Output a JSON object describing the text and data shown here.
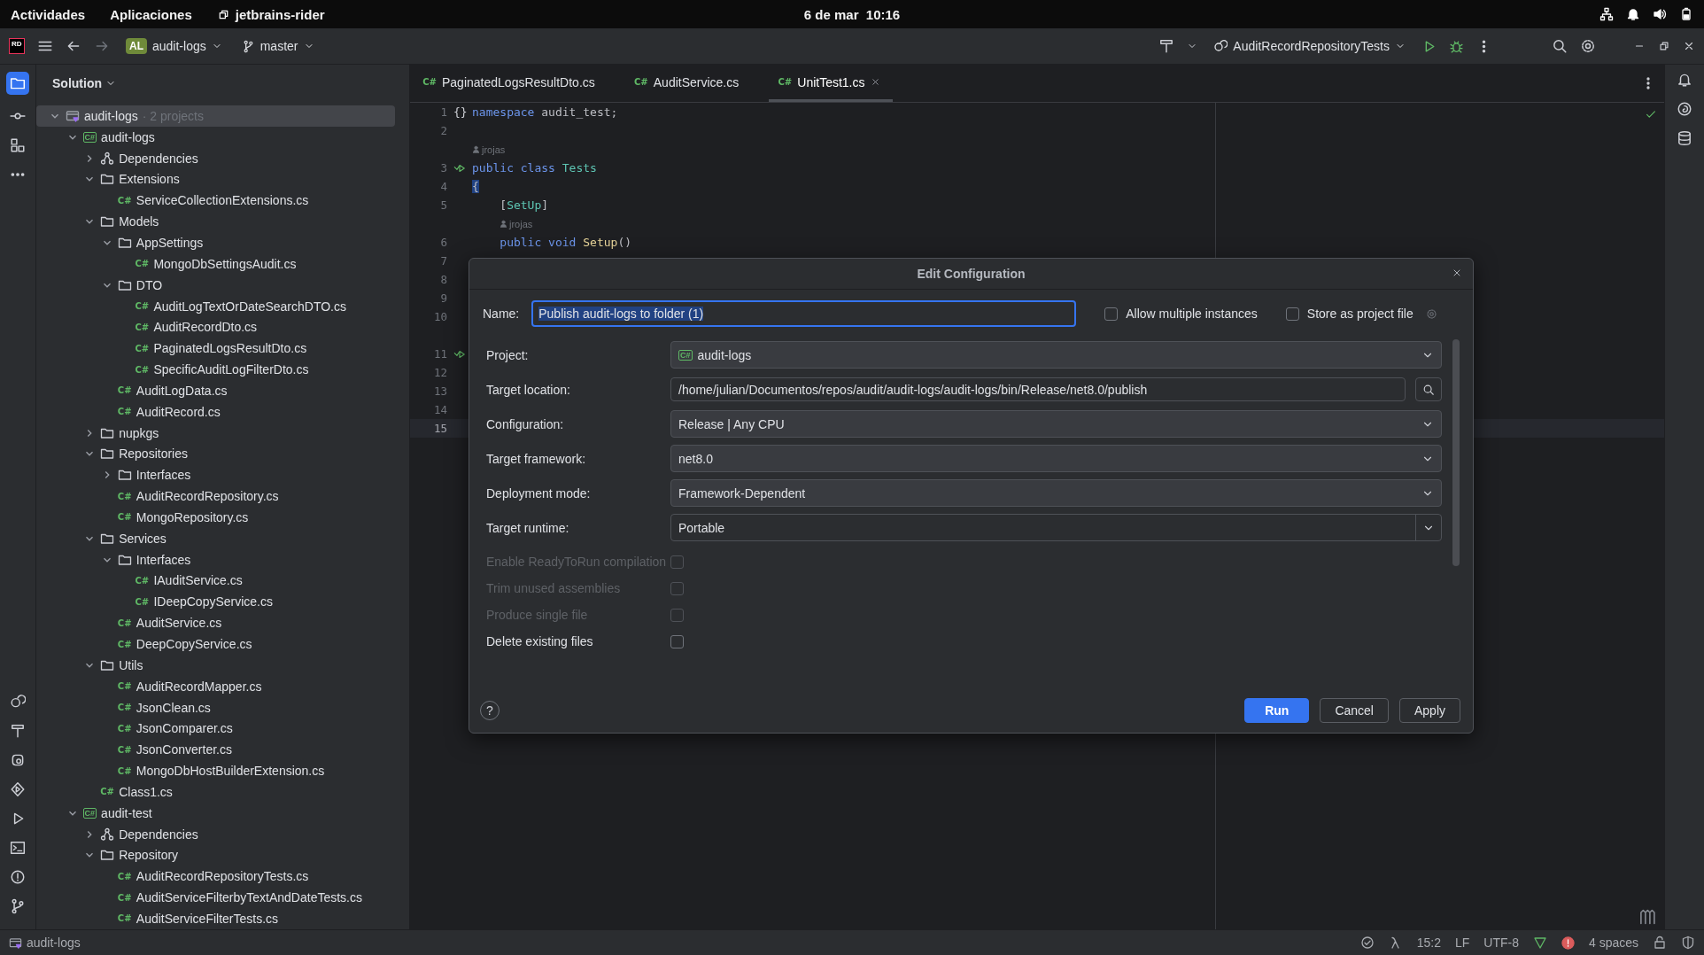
{
  "top_bar": {
    "activities": "Actividades",
    "applications": "Aplicaciones",
    "app": "jetbrains-rider",
    "clock": "6 de mar  10:16"
  },
  "toolbar": {
    "logo": "RD",
    "project_badge": "AL",
    "project": "audit-logs",
    "branch": "master",
    "run_config": "AuditRecordRepositoryTests"
  },
  "project_panel": {
    "title": "Solution",
    "tree": [
      {
        "label": "audit-logs",
        "kind": "solution",
        "note": "· 2 projects",
        "expanded": true,
        "selected": true,
        "children": [
          {
            "label": "audit-logs",
            "kind": "project",
            "icon_text": "C#",
            "expanded": true,
            "selected": false,
            "children": [
              {
                "label": "Dependencies",
                "kind": "dependencies",
                "expanded": false,
                "selected": false
              },
              {
                "label": "Extensions",
                "kind": "folder",
                "expanded": true,
                "selected": false,
                "children": [
                  {
                    "label": "ServiceCollectionExtensions.cs",
                    "kind": "file",
                    "icon_text": "C#",
                    "selected": false
                  }
                ]
              },
              {
                "label": "Models",
                "kind": "folder",
                "expanded": true,
                "selected": false,
                "children": [
                  {
                    "label": "AppSettings",
                    "kind": "folder",
                    "expanded": true,
                    "selected": false,
                    "children": [
                      {
                        "label": "MongoDbSettingsAudit.cs",
                        "kind": "file",
                        "icon_text": "C#",
                        "selected": false
                      }
                    ]
                  },
                  {
                    "label": "DTO",
                    "kind": "folder",
                    "expanded": true,
                    "selected": false,
                    "children": [
                      {
                        "label": "AuditLogTextOrDateSearchDTO.cs",
                        "kind": "file",
                        "icon_text": "C#",
                        "selected": false
                      },
                      {
                        "label": "AuditRecordDto.cs",
                        "kind": "file",
                        "icon_text": "C#",
                        "selected": false
                      },
                      {
                        "label": "PaginatedLogsResultDto.cs",
                        "kind": "file",
                        "icon_text": "C#",
                        "selected": false
                      },
                      {
                        "label": "SpecificAuditLogFilterDto.cs",
                        "kind": "file",
                        "icon_text": "C#",
                        "selected": false
                      }
                    ]
                  },
                  {
                    "label": "AuditLogData.cs",
                    "kind": "file",
                    "icon_text": "C#",
                    "selected": false
                  },
                  {
                    "label": "AuditRecord.cs",
                    "kind": "file",
                    "icon_text": "C#",
                    "selected": false
                  }
                ]
              },
              {
                "label": "nupkgs",
                "kind": "folder",
                "expanded": false,
                "selected": false
              },
              {
                "label": "Repositories",
                "kind": "folder",
                "expanded": true,
                "selected": false,
                "children": [
                  {
                    "label": "Interfaces",
                    "kind": "folder",
                    "expanded": false,
                    "selected": false
                  },
                  {
                    "label": "AuditRecordRepository.cs",
                    "kind": "file",
                    "icon_text": "C#",
                    "selected": false
                  },
                  {
                    "label": "MongoRepository.cs",
                    "kind": "file",
                    "icon_text": "C#",
                    "selected": false
                  }
                ]
              },
              {
                "label": "Services",
                "kind": "folder",
                "expanded": true,
                "selected": false,
                "children": [
                  {
                    "label": "Interfaces",
                    "kind": "folder",
                    "expanded": true,
                    "selected": false,
                    "children": [
                      {
                        "label": "IAuditService.cs",
                        "kind": "file",
                        "icon_text": "C#",
                        "selected": false
                      },
                      {
                        "label": "IDeepCopyService.cs",
                        "kind": "file",
                        "icon_text": "C#",
                        "selected": false
                      }
                    ]
                  },
                  {
                    "label": "AuditService.cs",
                    "kind": "file",
                    "icon_text": "C#",
                    "selected": false
                  },
                  {
                    "label": "DeepCopyService.cs",
                    "kind": "file",
                    "icon_text": "C#",
                    "selected": false
                  }
                ]
              },
              {
                "label": "Utils",
                "kind": "folder",
                "expanded": true,
                "selected": false,
                "children": [
                  {
                    "label": "AuditRecordMapper.cs",
                    "kind": "file",
                    "icon_text": "C#",
                    "selected": false
                  },
                  {
                    "label": "JsonClean.cs",
                    "kind": "file",
                    "icon_text": "C#",
                    "selected": false
                  },
                  {
                    "label": "JsonComparer.cs",
                    "kind": "file",
                    "icon_text": "C#",
                    "selected": false
                  },
                  {
                    "label": "JsonConverter.cs",
                    "kind": "file",
                    "icon_text": "C#",
                    "selected": false
                  },
                  {
                    "label": "MongoDbHostBuilderExtension.cs",
                    "kind": "file",
                    "icon_text": "C#",
                    "selected": false
                  }
                ]
              },
              {
                "label": "Class1.cs",
                "kind": "file",
                "icon_text": "C#",
                "selected": false
              }
            ]
          },
          {
            "label": "audit-test",
            "kind": "project",
            "icon_text": "C#",
            "expanded": true,
            "selected": false,
            "children": [
              {
                "label": "Dependencies",
                "kind": "dependencies",
                "expanded": false,
                "selected": false
              },
              {
                "label": "Repository",
                "kind": "folder",
                "expanded": true,
                "selected": false,
                "children": [
                  {
                    "label": "AuditRecordRepositoryTests.cs",
                    "kind": "file",
                    "icon_text": "C#",
                    "selected": false
                  },
                  {
                    "label": "AuditServiceFilterbyTextAndDateTests.cs",
                    "kind": "file",
                    "icon_text": "C#",
                    "selected": false
                  },
                  {
                    "label": "AuditServiceFilterTests.cs",
                    "kind": "file",
                    "icon_text": "C#",
                    "selected": false
                  }
                ]
              }
            ]
          }
        ]
      }
    ]
  },
  "editor": {
    "tabs": [
      {
        "icon_text": "C#",
        "label": "PaginatedLogsResultDto.cs",
        "selected": false,
        "closable": false
      },
      {
        "icon_text": "C#",
        "label": "AuditService.cs",
        "selected": false,
        "closable": false
      },
      {
        "icon_text": "C#",
        "label": "UnitTest1.cs",
        "selected": true,
        "closable": true
      }
    ],
    "lines": [
      {
        "kind": "code",
        "number": "1",
        "gutter_text": "{}",
        "runnable": false,
        "current": false,
        "segments": [
          {
            "kind": "keyword",
            "text": "namespace"
          },
          {
            "kind": "plain",
            "text": " audit_test;"
          }
        ]
      },
      {
        "kind": "code",
        "number": "2",
        "runnable": false,
        "current": false
      },
      {
        "kind": "author",
        "text": "jrojas",
        "indented": false
      },
      {
        "kind": "code",
        "number": "3",
        "runnable": true,
        "current": false,
        "segments": [
          {
            "kind": "keyword",
            "text": "public class "
          },
          {
            "kind": "type",
            "text": "Tests"
          }
        ]
      },
      {
        "kind": "code",
        "number": "4",
        "runnable": false,
        "current": false,
        "segments": [
          {
            "kind": "brace_match",
            "text": "{"
          }
        ]
      },
      {
        "kind": "code",
        "number": "5",
        "runnable": false,
        "current": false,
        "segments": [
          {
            "kind": "plain",
            "text": "    ["
          },
          {
            "kind": "type",
            "text": "SetUp"
          },
          {
            "kind": "plain",
            "text": "]"
          }
        ]
      },
      {
        "kind": "author",
        "text": "jrojas",
        "indented": true
      },
      {
        "kind": "code",
        "number": "6",
        "runnable": false,
        "current": false,
        "segments": [
          {
            "kind": "keyword",
            "text": "    public void "
          },
          {
            "kind": "method",
            "text": "Setup"
          },
          {
            "kind": "plain",
            "text": "()"
          }
        ]
      },
      {
        "kind": "code",
        "number": "7",
        "runnable": false,
        "current": false
      },
      {
        "kind": "code",
        "number": "8",
        "runnable": false,
        "current": false
      },
      {
        "kind": "code",
        "number": "9",
        "runnable": false,
        "current": false
      },
      {
        "kind": "code",
        "number": "10",
        "runnable": false,
        "current": false
      },
      {
        "kind": "author"
      },
      {
        "kind": "code",
        "number": "11",
        "runnable": true,
        "current": false
      },
      {
        "kind": "code",
        "number": "12",
        "runnable": false,
        "current": false
      },
      {
        "kind": "code",
        "number": "13",
        "runnable": false,
        "current": false
      },
      {
        "kind": "code",
        "number": "14",
        "runnable": false,
        "current": false
      },
      {
        "kind": "code",
        "number": "15",
        "runnable": false,
        "current": true
      }
    ]
  },
  "dialog": {
    "title": "Edit Configuration",
    "name_label": "Name:",
    "name_value": "Publish audit-logs to folder (1)",
    "header_checks": [
      {
        "label": "Allow multiple instances",
        "checked": false
      },
      {
        "label": "Store as project file",
        "checked": false
      }
    ],
    "fields": [
      {
        "label": "Project:",
        "kind": "dropdown",
        "icon_text": "C#",
        "value": "audit-logs"
      },
      {
        "label": "Target location:",
        "kind": "path",
        "value": "/home/julian/Documentos/repos/audit/audit-logs/audit-logs/bin/Release/net8.0/publish"
      },
      {
        "label": "Configuration:",
        "kind": "dropdown",
        "value": "Release | Any CPU"
      },
      {
        "label": "Target framework:",
        "kind": "dropdown",
        "value": "net8.0"
      },
      {
        "label": "Deployment mode:",
        "kind": "dropdown",
        "value": "Framework-Dependent"
      },
      {
        "label": "Target runtime:",
        "kind": "combo",
        "value": "Portable"
      }
    ],
    "options": [
      {
        "label": "Enable ReadyToRun compilation",
        "checked": false,
        "disabled": true
      },
      {
        "label": "Trim unused assemblies",
        "checked": false,
        "disabled": true
      },
      {
        "label": "Produce single file",
        "checked": false,
        "disabled": true
      },
      {
        "label": "Delete existing files",
        "checked": false,
        "disabled": false
      }
    ],
    "help": "?",
    "buttons": [
      {
        "label": "Run",
        "kind": "primary"
      },
      {
        "label": "Cancel",
        "kind": "secondary"
      },
      {
        "label": "Apply",
        "kind": "secondary"
      }
    ]
  },
  "status_bar": {
    "project": "audit-logs",
    "position": "15:2",
    "line_ending": "LF",
    "encoding": "UTF-8",
    "indent": "4 spaces"
  }
}
